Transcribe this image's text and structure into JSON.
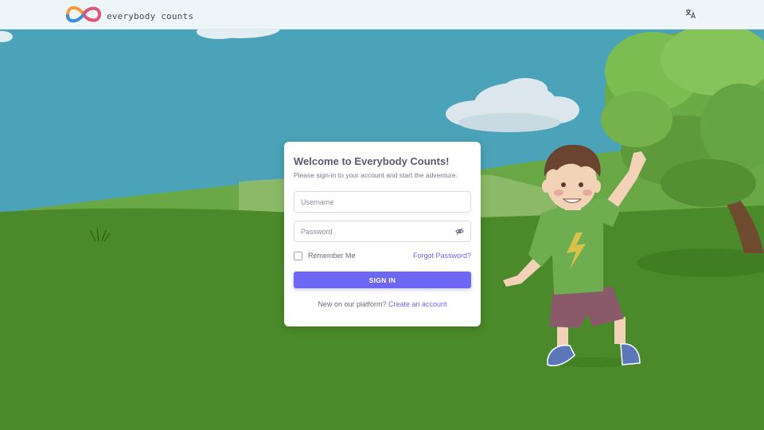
{
  "header": {
    "logo_text": "everybody counts",
    "logo_icon": "infinity-logo-icon",
    "language_icon": "translate-icon"
  },
  "login": {
    "title": "Welcome to Everybody Counts!",
    "subtitle": "Please sign-in to your account and start the adventure.",
    "username_placeholder": "Username",
    "username_value": "",
    "password_placeholder": "Password",
    "password_value": "",
    "password_toggle_icon": "eye-off-icon",
    "remember_label": "Remember Me",
    "remember_checked": false,
    "forgot_label": "Forgot Password?",
    "signin_label": "SIGN IN",
    "new_text": "New on our platform?",
    "create_label": "Create an account"
  },
  "colors": {
    "primary": "#6e67f4",
    "link": "#6c63ff",
    "sky": "#4a9fb6",
    "grass": "#4b8a2a"
  }
}
